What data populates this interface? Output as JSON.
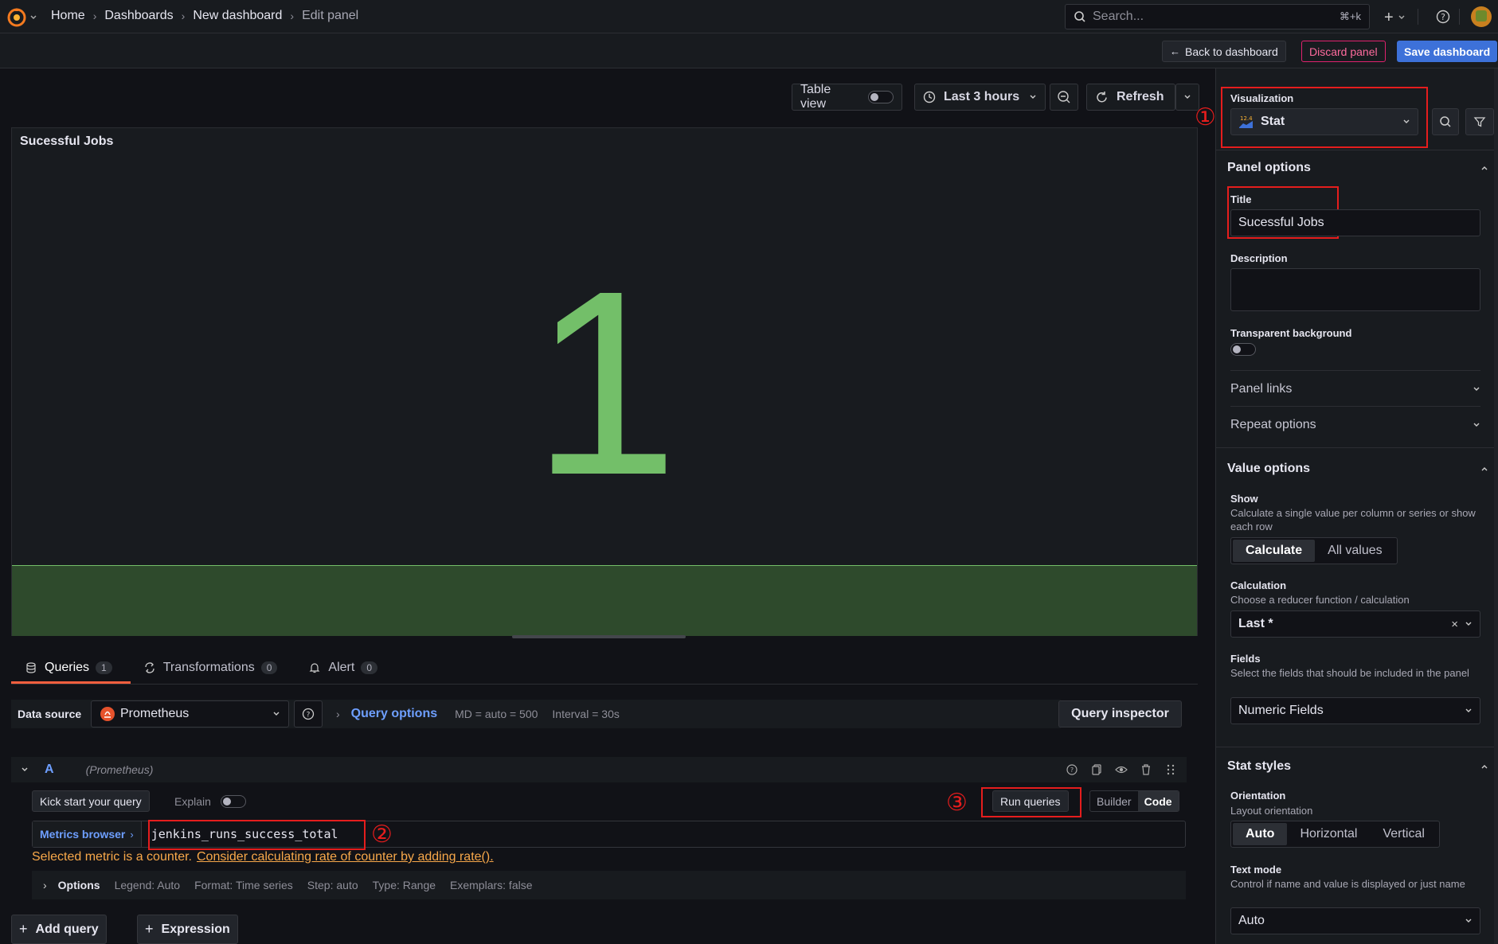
{
  "breadcrumbs": [
    "Home",
    "Dashboards",
    "New dashboard"
  ],
  "breadcrumb_current": "Edit panel",
  "search": {
    "placeholder": "Search...",
    "shortcut": "⌘+k"
  },
  "actions": {
    "back": "Back to dashboard",
    "discard": "Discard panel",
    "save": "Save dashboard"
  },
  "toolbar": {
    "table_view": "Table view",
    "time_range": "Last 3 hours",
    "refresh": "Refresh"
  },
  "panel": {
    "title": "Sucessful Jobs",
    "stat_value": "1",
    "value_color": "#73bf69"
  },
  "tabs": [
    {
      "label": "Queries",
      "count": "1"
    },
    {
      "label": "Transformations",
      "count": "0"
    },
    {
      "label": "Alert",
      "count": "0"
    }
  ],
  "datasource": {
    "label": "Data source",
    "value": "Prometheus",
    "query_options": "Query options",
    "md": "MD = auto = 500",
    "interval": "Interval = 30s",
    "inspector": "Query inspector"
  },
  "query": {
    "ref": "A",
    "source": "(Prometheus)",
    "kickstart": "Kick start your query",
    "explain": "Explain",
    "run": "Run queries",
    "builder": "Builder",
    "code": "Code",
    "metrics_browser": "Metrics browser",
    "expression": "jenkins_runs_success_total",
    "warning": "Selected metric is a counter.",
    "warning_link": "Consider calculating rate of counter by adding rate().",
    "options_label": "Options",
    "legend": "Legend: Auto",
    "format": "Format: Time series",
    "step": "Step: auto",
    "type": "Type: Range",
    "exemplars": "Exemplars: false"
  },
  "bottom": {
    "add_query": "Add query",
    "expression": "Expression"
  },
  "sidebar": {
    "visualization_label": "Visualization",
    "visualization": "Stat",
    "panel_options": "Panel options",
    "title_label": "Title",
    "title_value": "Sucessful Jobs",
    "description_label": "Description",
    "transparent_label": "Transparent background",
    "panel_links": "Panel links",
    "repeat_options": "Repeat options",
    "value_options": "Value options",
    "show_label": "Show",
    "show_desc": "Calculate a single value per column or series or show each row",
    "show_opts": [
      "Calculate",
      "All values"
    ],
    "calc_label": "Calculation",
    "calc_desc": "Choose a reducer function / calculation",
    "calc_value": "Last *",
    "fields_label": "Fields",
    "fields_desc": "Select the fields that should be included in the panel",
    "fields_value": "Numeric Fields",
    "stat_styles": "Stat styles",
    "orientation_label": "Orientation",
    "orientation_desc": "Layout orientation",
    "orientation_opts": [
      "Auto",
      "Horizontal",
      "Vertical"
    ],
    "text_mode_label": "Text mode",
    "text_mode_desc": "Control if name and value is displayed or just name",
    "text_mode_value": "Auto"
  },
  "annotations": [
    "①",
    "②",
    "③"
  ],
  "colors": {
    "accent": "#3d71d9",
    "danger": "#e0226e",
    "stat_green": "#73bf69",
    "annotation_red": "#e51d1d"
  }
}
